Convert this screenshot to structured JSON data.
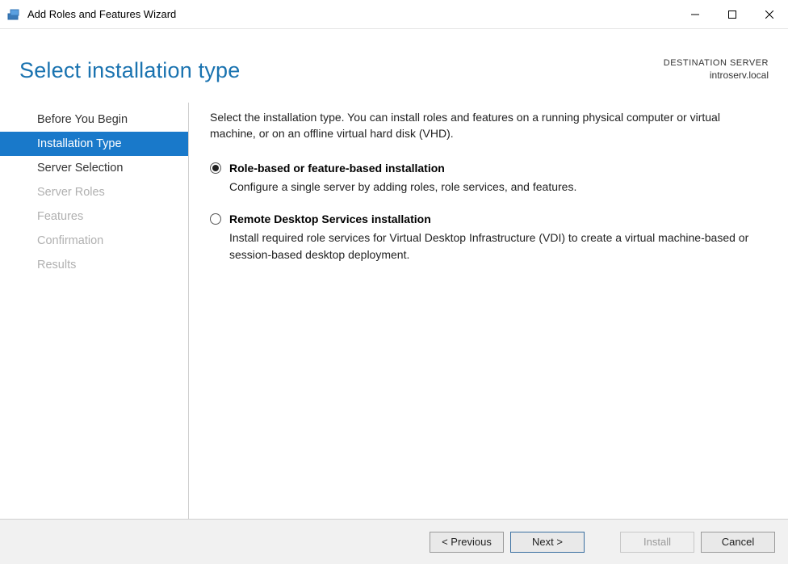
{
  "window": {
    "title": "Add Roles and Features Wizard"
  },
  "header": {
    "page_title": "Select installation type",
    "dest_label": "DESTINATION SERVER",
    "dest_name": "introserv.local"
  },
  "sidebar": {
    "steps": [
      {
        "label": "Before You Begin",
        "state": "done"
      },
      {
        "label": "Installation Type",
        "state": "active"
      },
      {
        "label": "Server Selection",
        "state": "done"
      },
      {
        "label": "Server Roles",
        "state": "disabled"
      },
      {
        "label": "Features",
        "state": "disabled"
      },
      {
        "label": "Confirmation",
        "state": "disabled"
      },
      {
        "label": "Results",
        "state": "disabled"
      }
    ]
  },
  "pane": {
    "intro": "Select the installation type. You can install roles and features on a running physical computer or virtual machine, or on an offline virtual hard disk (VHD).",
    "options": [
      {
        "title": "Role-based or feature-based installation",
        "desc": "Configure a single server by adding roles, role services, and features.",
        "checked": true
      },
      {
        "title": "Remote Desktop Services installation",
        "desc": "Install required role services for Virtual Desktop Infrastructure (VDI) to create a virtual machine-based or session-based desktop deployment.",
        "checked": false
      }
    ]
  },
  "footer": {
    "previous": "< Previous",
    "next": "Next >",
    "install": "Install",
    "cancel": "Cancel"
  }
}
